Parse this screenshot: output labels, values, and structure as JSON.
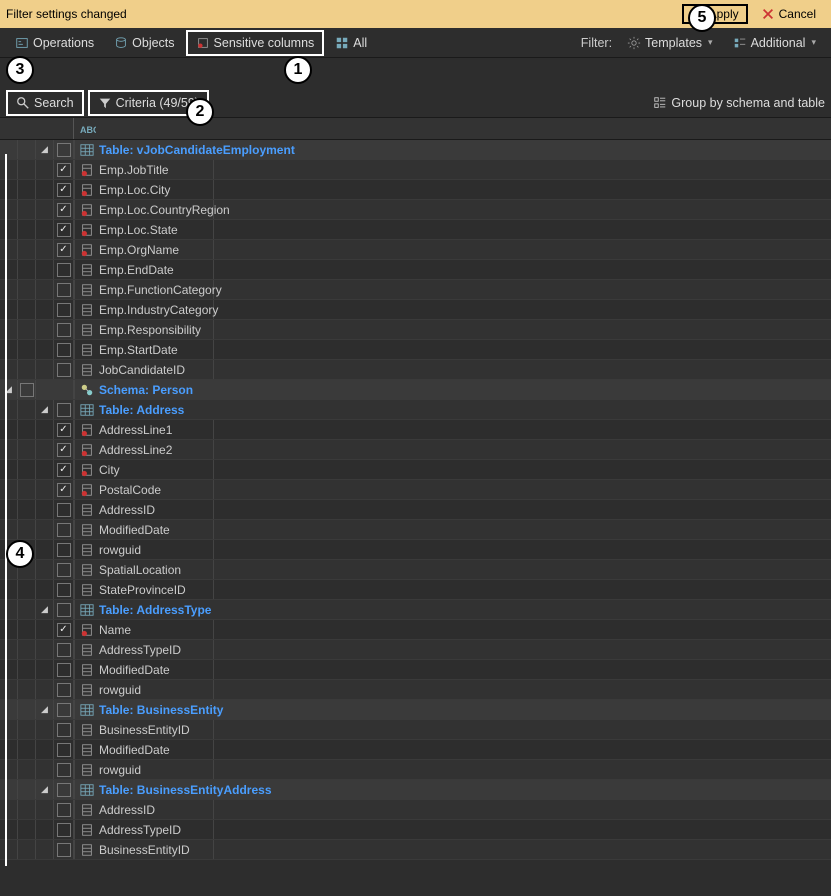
{
  "banner": {
    "message": "Filter settings changed",
    "apply": "Apply",
    "cancel": "Cancel"
  },
  "toolbar": {
    "operations": "Operations",
    "objects": "Objects",
    "sensitive": "Sensitive columns",
    "all": "All",
    "filter_label": "Filter:",
    "templates": "Templates",
    "additional": "Additional"
  },
  "subtoolbar": {
    "search": "Search",
    "criteria": "Criteria (49/59)",
    "group": "Group by schema and table"
  },
  "header_col": "ABC",
  "tree": [
    {
      "type": "table",
      "text": "Table: vJobCandidateEmployment",
      "level": 2
    },
    {
      "type": "col",
      "text": "Emp.JobTitle",
      "sens": true,
      "checked": true,
      "level": 3
    },
    {
      "type": "col",
      "text": "Emp.Loc.City",
      "sens": true,
      "checked": true,
      "level": 3
    },
    {
      "type": "col",
      "text": "Emp.Loc.CountryRegion",
      "sens": true,
      "checked": true,
      "level": 3
    },
    {
      "type": "col",
      "text": "Emp.Loc.State",
      "sens": true,
      "checked": true,
      "level": 3
    },
    {
      "type": "col",
      "text": "Emp.OrgName",
      "sens": true,
      "checked": true,
      "level": 3
    },
    {
      "type": "col",
      "text": "Emp.EndDate",
      "sens": false,
      "checked": false,
      "level": 3
    },
    {
      "type": "col",
      "text": "Emp.FunctionCategory",
      "sens": false,
      "checked": false,
      "level": 3
    },
    {
      "type": "col",
      "text": "Emp.IndustryCategory",
      "sens": false,
      "checked": false,
      "level": 3
    },
    {
      "type": "col",
      "text": "Emp.Responsibility",
      "sens": false,
      "checked": false,
      "level": 3
    },
    {
      "type": "col",
      "text": "Emp.StartDate",
      "sens": false,
      "checked": false,
      "level": 3
    },
    {
      "type": "col",
      "text": "JobCandidateID",
      "sens": false,
      "checked": false,
      "level": 3
    },
    {
      "type": "schema",
      "text": "Schema: Person",
      "level": 1
    },
    {
      "type": "table",
      "text": "Table: Address",
      "level": 2
    },
    {
      "type": "col",
      "text": "AddressLine1",
      "sens": true,
      "checked": true,
      "level": 3
    },
    {
      "type": "col",
      "text": "AddressLine2",
      "sens": true,
      "checked": true,
      "level": 3
    },
    {
      "type": "col",
      "text": "City",
      "sens": true,
      "checked": true,
      "level": 3
    },
    {
      "type": "col",
      "text": "PostalCode",
      "sens": true,
      "checked": true,
      "level": 3
    },
    {
      "type": "col",
      "text": "AddressID",
      "sens": false,
      "checked": false,
      "level": 3
    },
    {
      "type": "col",
      "text": "ModifiedDate",
      "sens": false,
      "checked": false,
      "level": 3
    },
    {
      "type": "col",
      "text": "rowguid",
      "sens": false,
      "checked": false,
      "level": 3
    },
    {
      "type": "col",
      "text": "SpatialLocation",
      "sens": false,
      "checked": false,
      "level": 3
    },
    {
      "type": "col",
      "text": "StateProvinceID",
      "sens": false,
      "checked": false,
      "level": 3
    },
    {
      "type": "table",
      "text": "Table: AddressType",
      "level": 2
    },
    {
      "type": "col",
      "text": "Name",
      "sens": true,
      "checked": true,
      "level": 3
    },
    {
      "type": "col",
      "text": "AddressTypeID",
      "sens": false,
      "checked": false,
      "level": 3
    },
    {
      "type": "col",
      "text": "ModifiedDate",
      "sens": false,
      "checked": false,
      "level": 3
    },
    {
      "type": "col",
      "text": "rowguid",
      "sens": false,
      "checked": false,
      "level": 3
    },
    {
      "type": "table",
      "text": "Table: BusinessEntity",
      "level": 2
    },
    {
      "type": "col",
      "text": "BusinessEntityID",
      "sens": false,
      "checked": false,
      "level": 3
    },
    {
      "type": "col",
      "text": "ModifiedDate",
      "sens": false,
      "checked": false,
      "level": 3
    },
    {
      "type": "col",
      "text": "rowguid",
      "sens": false,
      "checked": false,
      "level": 3
    },
    {
      "type": "table",
      "text": "Table: BusinessEntityAddress",
      "level": 2
    },
    {
      "type": "col",
      "text": "AddressID",
      "sens": false,
      "checked": false,
      "level": 3
    },
    {
      "type": "col",
      "text": "AddressTypeID",
      "sens": false,
      "checked": false,
      "level": 3
    },
    {
      "type": "col",
      "text": "BusinessEntityID",
      "sens": false,
      "checked": false,
      "level": 3
    }
  ],
  "callouts": {
    "c1": "1",
    "c2": "2",
    "c3": "3",
    "c4": "4",
    "c5": "5"
  }
}
